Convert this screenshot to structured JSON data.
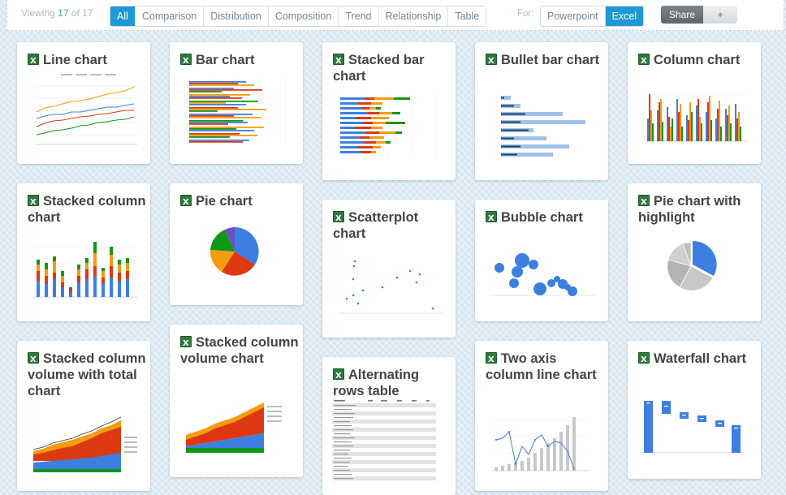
{
  "toolbar": {
    "viewing_prefix": "Viewing ",
    "viewing_shown": "17",
    "viewing_mid": " of ",
    "viewing_total": "17",
    "filters": [
      "All",
      "Comparison",
      "Distribution",
      "Composition",
      "Trend",
      "Relationship",
      "Table"
    ],
    "active_filter": "All",
    "for_label": "For:",
    "targets": [
      "Powerpoint",
      "Excel"
    ],
    "active_target": "Excel",
    "share_label": "Share",
    "plus_label": "+"
  },
  "colors": {
    "accent": "#1f98d6",
    "series_blue": "#3d7fe0",
    "series_red": "#dc3912",
    "series_orange": "#f39c12",
    "series_green": "#109618",
    "series_purple": "#6f4cc4",
    "excel_green": "#2e7a3c"
  },
  "cards": [
    {
      "title": "Line chart",
      "thumb": "line"
    },
    {
      "title": "Bar chart",
      "thumb": "bar"
    },
    {
      "title": "Stacked bar chart",
      "thumb": "stackedbar"
    },
    {
      "title": "Bullet bar chart",
      "thumb": "bullet"
    },
    {
      "title": "Column chart",
      "thumb": "column"
    },
    {
      "title": "Stacked column chart",
      "thumb": "stackedcol"
    },
    {
      "title": "Pie chart",
      "thumb": "pie"
    },
    {
      "title": "Scatterplot chart",
      "thumb": "scatter"
    },
    {
      "title": "Bubble chart",
      "thumb": "bubble"
    },
    {
      "title": "Pie chart with highlight",
      "thumb": "piehl"
    },
    {
      "title": "Stacked column volume with total chart",
      "thumb": "volumetotal"
    },
    {
      "title": "Stacked column volume chart",
      "thumb": "volume"
    },
    {
      "title": "Alternating rows table",
      "thumb": "table"
    },
    {
      "title": "Two axis column line chart",
      "thumb": "twoaxis"
    },
    {
      "title": "Waterfall chart",
      "thumb": "waterfall"
    }
  ]
}
